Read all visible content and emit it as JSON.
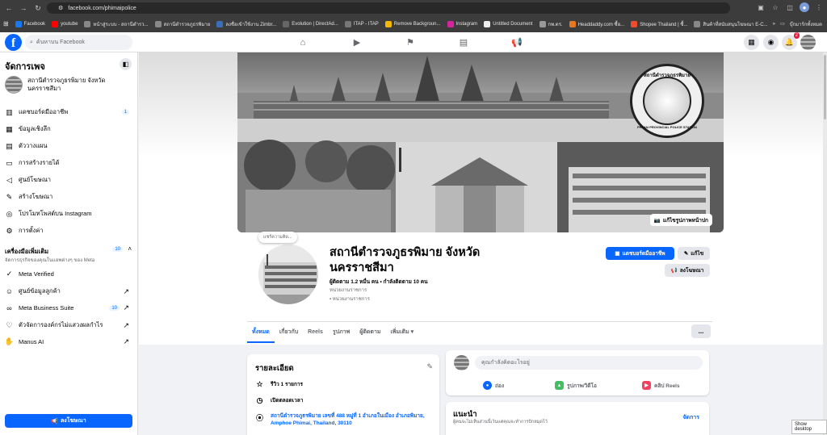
{
  "browser": {
    "url": "facebook.com/phimaipolice",
    "bookmarks": [
      {
        "label": "Facebook",
        "color": "#1877f2"
      },
      {
        "label": "youtube",
        "color": "#ff0000"
      },
      {
        "label": "หน้าสู่ระบบ - สถานีตำรว...",
        "color": "#888888"
      },
      {
        "label": "สถานีตำรวจภูธรพิมาย",
        "color": "#888888"
      },
      {
        "label": "ลงชื่อเข้าใช้งาน Zimbr...",
        "color": "#3a6fb7"
      },
      {
        "label": "Evolution | DirectAd...",
        "color": "#666666"
      },
      {
        "label": "ITAP - ITAP",
        "color": "#777777"
      },
      {
        "label": "Remove Backgroun...",
        "color": "#f5b700"
      },
      {
        "label": "Instagram",
        "color": "#d6249f"
      },
      {
        "label": "Untitled Document",
        "color": "#eeeeee"
      },
      {
        "label": "กพ.ตร.",
        "color": "#999999"
      },
      {
        "label": "Headdaddy.com ซื้อ...",
        "color": "#e87722"
      },
      {
        "label": "Shopee Thailand | ซื้...",
        "color": "#ee4d2d"
      },
      {
        "label": "สินค้าที่สนับสนุนโฆษณา E-C...",
        "color": "#888888"
      }
    ],
    "bookmarks_all": "บุ๊กมาร์กทั้งหมด"
  },
  "fb_top": {
    "search_placeholder": "ค้นหาบน Facebook",
    "notif_count": "2"
  },
  "sidebar": {
    "title": "จัดการเพจ",
    "page_name": "สถานีตำรวจภูธรพิมาย จังหวัดนครราชสีมา",
    "items": [
      {
        "label": "แดชบอร์ดมืออาชีพ",
        "icon": "chart-icon",
        "badge": "1"
      },
      {
        "label": "ข้อมูลเชิงลึก",
        "icon": "insights-icon"
      },
      {
        "label": "ตัววางแผน",
        "icon": "calendar-icon"
      },
      {
        "label": "การสร้างรายได้",
        "icon": "money-icon"
      },
      {
        "label": "ศูนย์โฆษณา",
        "icon": "megaphone-icon"
      },
      {
        "label": "สร้างโฆษณา",
        "icon": "pencil-icon"
      },
      {
        "label": "โปรโมทโพสต์บน Instagram",
        "icon": "instagram-icon"
      },
      {
        "label": "การตั้งค่า",
        "icon": "gear-icon"
      }
    ],
    "tools_title": "เครื่องมือเพิ่มเติม",
    "tools_badge": "10",
    "tools_sub": "จัดการธุรกิจของคุณในแอพต่างๆ ของ Meta",
    "tools": [
      {
        "label": "Meta Verified",
        "icon": "verified-icon"
      },
      {
        "label": "ศูนย์ข้อมูลลูกค้า",
        "icon": "people-icon",
        "arrow": "↗"
      },
      {
        "label": "Meta Business Suite",
        "icon": "meta-icon",
        "badge": "10",
        "arrow": "↗"
      },
      {
        "label": "ตัวจัดการองค์กรไม่แสวงผลกำไร",
        "icon": "nonprofit-icon",
        "arrow": "↗"
      },
      {
        "label": "Manus AI",
        "icon": "manus-icon",
        "arrow": "↗"
      }
    ],
    "ad_button": "ลงโฆษณา"
  },
  "cover": {
    "edit_cover": "แก้ไขรูปภาพหน้าปก",
    "seal_top": "สถานีตำรวจภูธรพิมาย",
    "seal_bottom": "PHIMAI PROVINCIAL POLICE STATION"
  },
  "profile": {
    "note": "แชร์ความคิด...",
    "name": "สถานีตำรวจภูธรพิมาย จังหวัดนครราชสีมา",
    "followers": "ผู้ติดตาม 1.2 หมื่น คน • กำลังติดตาม 10 คน",
    "category": "หน่วยงานราชการ",
    "category2": "หน่วยงานราชการ",
    "btn_dashboard": "แดชบอร์ดมืออาชีพ",
    "btn_edit": "แก้ไข",
    "btn_ad": "ลงโฆษณา"
  },
  "tabs": [
    "ทั้งหมด",
    "เกี่ยวกับ",
    "Reels",
    "รูปภาพ",
    "ผู้ติดตาม",
    "เพิ่มเติม ▾"
  ],
  "tabs_more": "...",
  "details": {
    "title": "รายละเอียด",
    "reviews": "รีวิว 1 รายการ",
    "hours": "เปิดตลอดเวลา",
    "address": "สถานีตำรวจภูธรพิมาย เลขที่ 488 หมู่ที่ 1 อำเภอในเมือง อำเภอพิมาย, Amphoe Phimai, Thailand, 30110"
  },
  "composer": {
    "placeholder": "คุณกำลังคิดอะไรอยู่",
    "live": "ถ่อง",
    "photo": "รูปภาพ/วิดีโอ",
    "reels": "คลิป Reels"
  },
  "suggest": {
    "title": "แนะนำ",
    "sub": "ผู้คนจะไม่เห็นส่วนนี้เว้นแต่คุณจะทำการปักหมุดไว้",
    "manage": "จัดการ"
  },
  "show_desktop": "Show desktop"
}
